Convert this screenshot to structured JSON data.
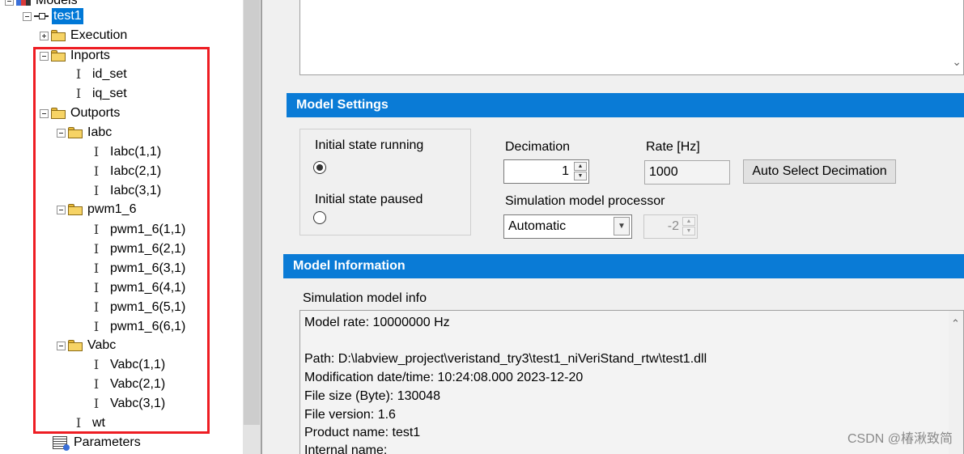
{
  "tree": {
    "root_label": "Models",
    "model_label": "test1",
    "execution_label": "Execution",
    "inports_label": "Inports",
    "inports": [
      "id_set",
      "iq_set"
    ],
    "outports_label": "Outports",
    "iabc_label": "Iabc",
    "iabc": [
      "Iabc(1,1)",
      "Iabc(2,1)",
      "Iabc(3,1)"
    ],
    "pwm_label": "pwm1_6",
    "pwm": [
      "pwm1_6(1,1)",
      "pwm1_6(2,1)",
      "pwm1_6(3,1)",
      "pwm1_6(4,1)",
      "pwm1_6(5,1)",
      "pwm1_6(6,1)"
    ],
    "vabc_label": "Vabc",
    "vabc": [
      "Vabc(1,1)",
      "Vabc(2,1)",
      "Vabc(3,1)"
    ],
    "wt_label": "wt",
    "parameters_label": "Parameters",
    "signal_icon_glyph": "I",
    "highlight_color": "#ee1d23"
  },
  "settings": {
    "header": "Model Settings",
    "running_label": "Initial state running",
    "paused_label": "Initial state paused",
    "selected_state": "running",
    "decimation_label": "Decimation",
    "decimation_value": "1",
    "rate_label": "Rate [Hz]",
    "rate_value": "1000",
    "auto_button": "Auto Select Decimation",
    "processor_label": "Simulation model processor",
    "processor_value": "Automatic",
    "processor_number": "-2"
  },
  "info": {
    "header": "Model Information",
    "box_label": "Simulation model info",
    "lines": [
      "Model rate: 10000000 Hz",
      "",
      "Path: D:\\labview_project\\veristand_try3\\test1_niVeriStand_rtw\\test1.dll",
      "Modification date/time: 10:24:08.000 2023-12-20",
      "File size (Byte): 130048",
      "File version: 1.6",
      "Product name: test1",
      "Internal name:"
    ]
  },
  "accent_color": "#0a7bd6",
  "watermark": "CSDN @椿湫致简"
}
